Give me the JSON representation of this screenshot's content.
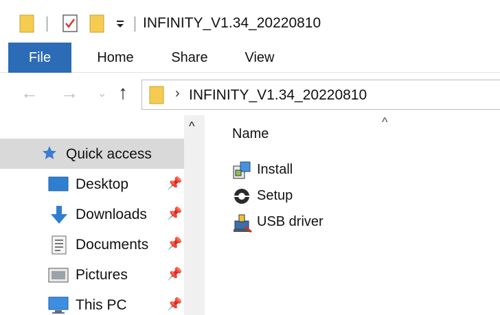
{
  "window": {
    "title": "INFINITY_V1.34_20220810"
  },
  "ribbon": {
    "tabs": [
      "File",
      "Home",
      "Share",
      "View"
    ]
  },
  "nav": {
    "back_glyph": "←",
    "forward_glyph": "→",
    "recent_glyph": "⌄",
    "up_glyph": "↑",
    "breadcrumb_separator": "›",
    "path": "INFINITY_V1.34_20220810"
  },
  "sidebar": {
    "items": [
      {
        "label": "Quick access",
        "icon": "star-icon",
        "pinned": false,
        "selected": true
      },
      {
        "label": "Desktop",
        "icon": "desktop-icon",
        "pinned": true
      },
      {
        "label": "Downloads",
        "icon": "download-arrow-icon",
        "pinned": true
      },
      {
        "label": "Documents",
        "icon": "document-icon",
        "pinned": true
      },
      {
        "label": "Pictures",
        "icon": "pictures-icon",
        "pinned": true
      },
      {
        "label": "This PC",
        "icon": "computer-icon",
        "pinned": true
      }
    ],
    "pin_glyph": "📌",
    "scroll_up_glyph": "^"
  },
  "main": {
    "column_name": "Name",
    "sort_glyph": "^",
    "files": [
      {
        "name": "Install",
        "icon": "installer-icon"
      },
      {
        "name": "Setup",
        "icon": "setup-gear-icon"
      },
      {
        "name": "USB driver",
        "icon": "usb-driver-icon"
      }
    ]
  },
  "colors": {
    "file_tab": "#2c6bb6",
    "folder": "#f5cc4f",
    "selection": "#d9d9d9"
  }
}
